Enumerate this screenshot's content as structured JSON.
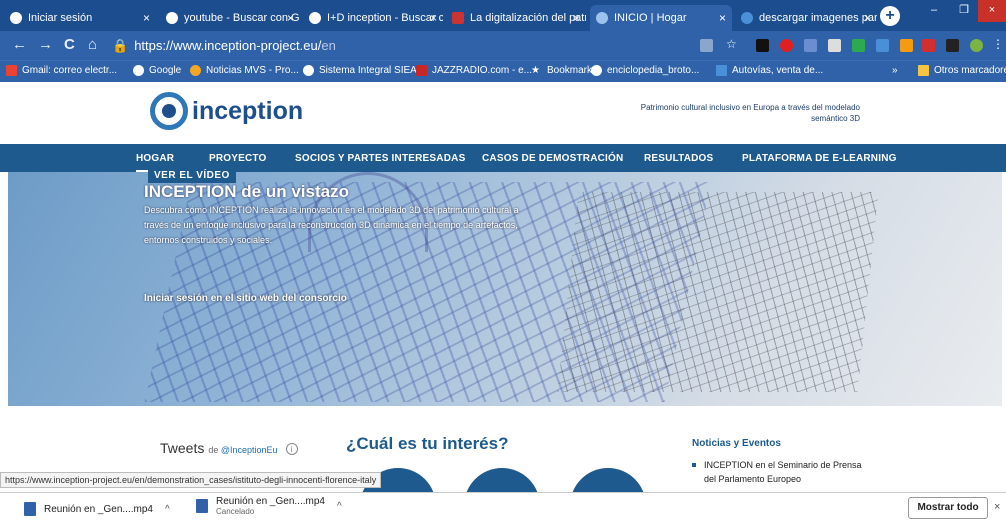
{
  "tabs": [
    {
      "title": "Iniciar sesión"
    },
    {
      "title": "youtube - Buscar con Go"
    },
    {
      "title": "I+D inception - Buscar co"
    },
    {
      "title": "La digitalización del patr"
    },
    {
      "title": "INICIO | Hogar"
    },
    {
      "title": "descargar imagenes par"
    }
  ],
  "tab_close": "×",
  "new_tab": "+",
  "window": {
    "minimize": "–",
    "maximize": "❐",
    "close": "×"
  },
  "address": {
    "host": "https://www.inception-project.eu/",
    "path": "en"
  },
  "nav": {
    "back": "←",
    "forward": "→",
    "reload": "C",
    "home": "⌂"
  },
  "bookmarks": [
    {
      "label": "Gmail: correo electr..."
    },
    {
      "label": "Google"
    },
    {
      "label": "Noticias MVS - Pro..."
    },
    {
      "label": "Sistema Integral SIEA"
    },
    {
      "label": "JAZZRADIO.com - e..."
    },
    {
      "label": "Bookmarks"
    },
    {
      "label": "enciclopedia_broto..."
    },
    {
      "label": "Autovías, venta de..."
    },
    {
      "label": "»"
    },
    {
      "label": "Otros marcadores"
    }
  ],
  "site": {
    "logo": "inception",
    "tagline": "Patrimonio cultural inclusivo en Europa a través del modelado semántico 3D",
    "menu": [
      "HOGAR",
      "PROYECTO",
      "SOCIOS Y PARTES INTERESADAS",
      "CASOS DE DEMOSTRACIÓN",
      "RESULTADOS",
      "PLATAFORMA DE E-LEARNING"
    ],
    "hero": {
      "badge": "VER EL VÍDEO",
      "title": "INCEPTION de un vistazo",
      "desc": "Descubra cómo INCEPTION realiza la innovación en el modelado 3D del patrimonio cultural a través de un enfoque inclusivo para la reconstrucción 3D dinámica en el tiempo de artefactos, entornos construidos y sociales.",
      "login": "Iniciar sesión en el sitio web del consorcio"
    },
    "tweets": {
      "title": "Tweets",
      "prefix": "de",
      "handle": "@InceptionEu",
      "info": "i"
    },
    "interest": "¿Cuál es tu interés?",
    "news": {
      "title": "Noticias y Eventos",
      "item": "INCEPTION en el Seminario de Prensa del Parlamento Europeo"
    }
  },
  "status_url": "https://www.inception-project.eu/en/demonstration_cases/istituto-degli-innocenti-florence-italy",
  "downloads": [
    {
      "name": "Reunión en _Gen....mp4",
      "sub": ""
    },
    {
      "name": "Reunión en _Gen....mp4",
      "sub": "Cancelado"
    }
  ],
  "download_chevron": "^",
  "show_all": "Mostrar todo",
  "close_downloads": "×"
}
